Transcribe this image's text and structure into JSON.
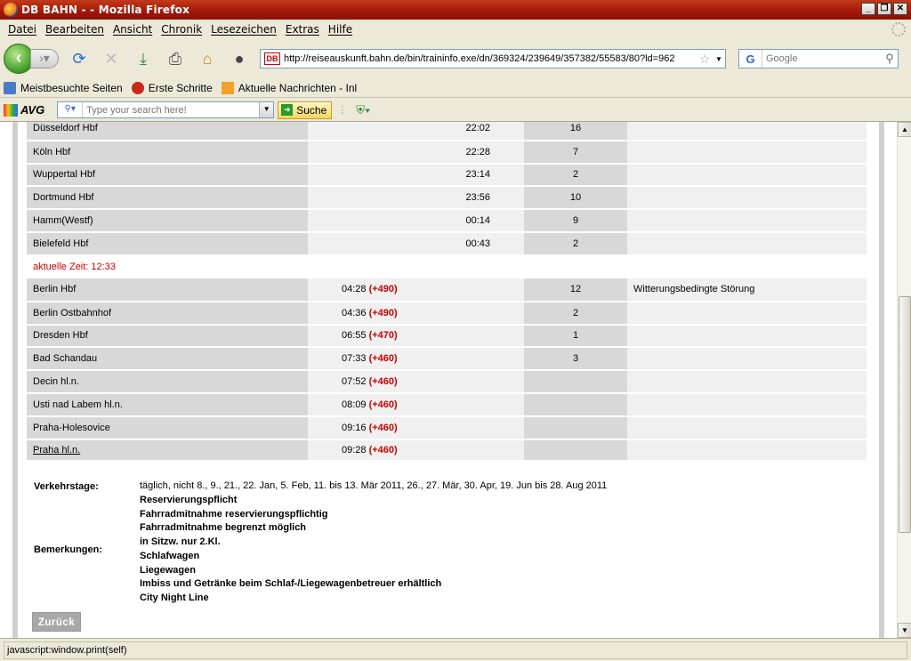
{
  "window": {
    "title": "DB BAHN - - Mozilla Firefox"
  },
  "menu": [
    "Datei",
    "Bearbeiten",
    "Ansicht",
    "Chronik",
    "Lesezeichen",
    "Extras",
    "Hilfe"
  ],
  "nav": {
    "url": "http://reiseauskunft.bahn.de/bin/traininfo.exe/dn/369324/239649/357382/55583/80?ld=962",
    "search_engine": "G",
    "search_placeholder": "Google"
  },
  "bookmarks": [
    "Meistbesuchte Seiten",
    "Erste Schritte",
    "Aktuelle Nachrichten - Inl"
  ],
  "avg": {
    "logo": "AVG",
    "search_placeholder": "Type your search here!",
    "search_button": "Suche"
  },
  "timetable": {
    "rows_before": [
      {
        "station": "Düsseldorf Hbf",
        "time": "22:02",
        "delay": "",
        "track": "16",
        "info": ""
      },
      {
        "station": "Köln Hbf",
        "time": "22:28",
        "delay": "",
        "track": "7",
        "info": ""
      },
      {
        "station": "Wuppertal Hbf",
        "time": "23:14",
        "delay": "",
        "track": "2",
        "info": ""
      },
      {
        "station": "Dortmund Hbf",
        "time": "23:56",
        "delay": "",
        "track": "10",
        "info": ""
      },
      {
        "station": "Hamm(Westf)",
        "time": "00:14",
        "delay": "",
        "track": "9",
        "info": ""
      },
      {
        "station": "Bielefeld Hbf",
        "time": "00:43",
        "delay": "",
        "track": "2",
        "info": ""
      }
    ],
    "current_time_label": "aktuelle Zeit: 12:33",
    "rows_after": [
      {
        "station": "Berlin Hbf",
        "time": "04:28",
        "delay": "(+490)",
        "track": "12",
        "info": "Witterungsbedingte Störung"
      },
      {
        "station": "Berlin Ostbahnhof",
        "time": "04:36",
        "delay": "(+490)",
        "track": "2",
        "info": ""
      },
      {
        "station": "Dresden Hbf",
        "time": "06:55",
        "delay": "(+470)",
        "track": "1",
        "info": ""
      },
      {
        "station": "Bad Schandau",
        "time": "07:33",
        "delay": "(+460)",
        "track": "3",
        "info": ""
      },
      {
        "station": "Decin hl.n.",
        "time": "07:52",
        "delay": "(+460)",
        "track": "",
        "info": ""
      },
      {
        "station": "Usti nad Labem hl.n.",
        "time": "08:09",
        "delay": "(+460)",
        "track": "",
        "info": ""
      },
      {
        "station": "Praha-Holesovice",
        "time": "09:16",
        "delay": "(+460)",
        "track": "",
        "info": ""
      },
      {
        "station": "Praha hl.n.",
        "time": "09:28",
        "delay": "(+460)",
        "track": "",
        "info": ""
      }
    ]
  },
  "details": {
    "verkehrstage_label": "Verkehrstage:",
    "verkehrstage_text": "täglich, nicht 8., 9., 21., 22. Jan, 5. Feb, 11. bis 13. Mär 2011, 26., 27. Mär, 30. Apr, 19. Jun bis 28. Aug 2011",
    "bemerkungen_label": "Bemerkungen:",
    "bemerkungen": [
      "Reservierungspflicht",
      "Fahrradmitnahme reservierungspflichtig",
      "Fahrradmitnahme begrenzt möglich",
      "in Sitzw. nur 2.Kl.",
      "Schlafwagen",
      "Liegewagen",
      "Imbiss und Getränke beim Schlaf-/Liegewagenbetreuer erhältlich",
      "City Night Line"
    ]
  },
  "back_button": "Zurück",
  "status": "javascript:window.print(self)"
}
